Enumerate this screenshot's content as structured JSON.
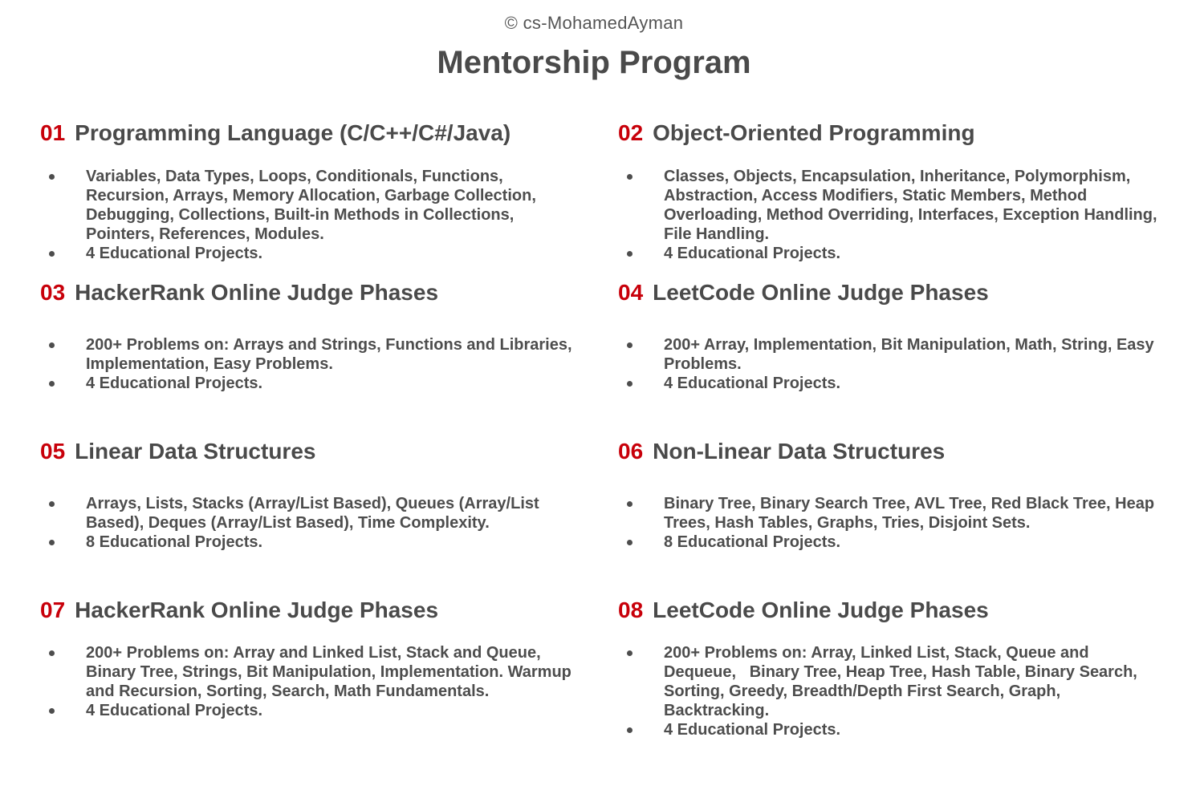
{
  "header": {
    "copyright": "© cs-MohamedAyman",
    "title": "Mentorship Program"
  },
  "sections": [
    {
      "num": "01",
      "title": "Programming Language (C/C++/C#/Java)",
      "items": [
        "Variables, Data Types, Loops, Conditionals, Functions, Recursion, Arrays, Memory Allocation, Garbage Collection, Debugging, Collections, Built-in Methods in Collections, Pointers, References, Modules.",
        "4 Educational Projects."
      ]
    },
    {
      "num": "02",
      "title": "Object-Oriented Programming",
      "items": [
        "Classes, Objects, Encapsulation, Inheritance, Polymorphism, Abstraction, Access Modifiers, Static Members, Method Overloading, Method Overriding, Interfaces, Exception Handling, File Handling.",
        "4 Educational Projects."
      ]
    },
    {
      "num": "03",
      "title": "HackerRank Online Judge Phases",
      "items": [
        "200+ Problems on: Arrays and Strings, Functions and Libraries, Implementation, Easy Problems.",
        "4 Educational Projects."
      ]
    },
    {
      "num": "04",
      "title": "LeetCode Online Judge Phases",
      "items": [
        "200+ Array, Implementation, Bit Manipulation, Math, String, Easy Problems.",
        "4 Educational Projects."
      ]
    },
    {
      "num": "05",
      "title": "Linear Data Structures",
      "items": [
        "Arrays, Lists, Stacks (Array/List Based), Queues (Array/List Based), Deques (Array/List Based), Time Complexity.",
        "8 Educational Projects."
      ]
    },
    {
      "num": "06",
      "title": "Non-Linear Data Structures",
      "items": [
        "Binary Tree, Binary Search Tree, AVL Tree, Red Black Tree, Heap Trees, Hash Tables, Graphs, Tries, Disjoint Sets.",
        "8 Educational Projects."
      ]
    },
    {
      "num": "07",
      "title": "HackerRank Online Judge Phases",
      "items": [
        "200+ Problems on: Array and Linked List, Stack and Queue, Binary Tree, Strings, Bit Manipulation, Implementation. Warmup and Recursion, Sorting, Search, Math Fundamentals.",
        "4 Educational Projects."
      ]
    },
    {
      "num": "08",
      "title": "LeetCode Online Judge Phases",
      "items": [
        "200+ Problems on: Array, Linked List, Stack, Queue and Dequeue,   Binary Tree, Heap Tree, Hash Table, Binary Search, Sorting, Greedy, Breadth/Depth First Search, Graph, Backtracking.",
        "4 Educational Projects."
      ]
    }
  ]
}
